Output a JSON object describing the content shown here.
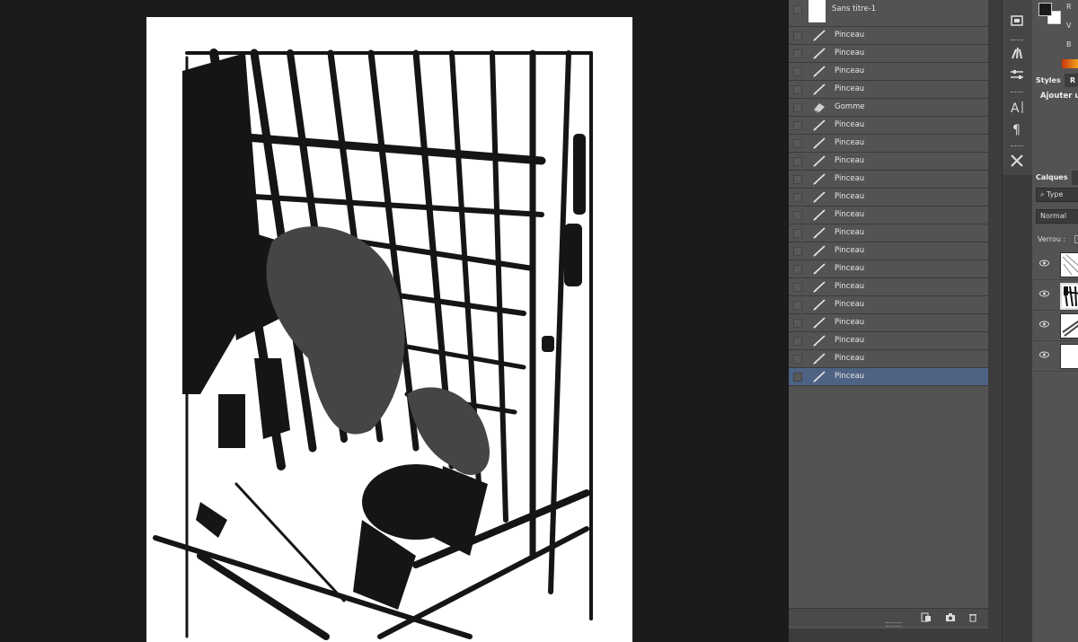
{
  "history": {
    "snapshot_label": "Sans titre-1",
    "steps": [
      {
        "label": "Pinceau",
        "icon": "brush-icon"
      },
      {
        "label": "Pinceau",
        "icon": "brush-icon"
      },
      {
        "label": "Pinceau",
        "icon": "brush-icon"
      },
      {
        "label": "Pinceau",
        "icon": "brush-icon"
      },
      {
        "label": "Gomme",
        "icon": "eraser-icon"
      },
      {
        "label": "Pinceau",
        "icon": "brush-icon"
      },
      {
        "label": "Pinceau",
        "icon": "brush-icon"
      },
      {
        "label": "Pinceau",
        "icon": "brush-icon"
      },
      {
        "label": "Pinceau",
        "icon": "brush-icon"
      },
      {
        "label": "Pinceau",
        "icon": "brush-icon"
      },
      {
        "label": "Pinceau",
        "icon": "brush-icon"
      },
      {
        "label": "Pinceau",
        "icon": "brush-icon"
      },
      {
        "label": "Pinceau",
        "icon": "brush-icon"
      },
      {
        "label": "Pinceau",
        "icon": "brush-icon"
      },
      {
        "label": "Pinceau",
        "icon": "brush-icon"
      },
      {
        "label": "Pinceau",
        "icon": "brush-icon"
      },
      {
        "label": "Pinceau",
        "icon": "brush-icon"
      },
      {
        "label": "Pinceau",
        "icon": "brush-icon"
      },
      {
        "label": "Pinceau",
        "icon": "brush-icon"
      },
      {
        "label": "Pinceau",
        "icon": "brush-icon"
      }
    ],
    "active_index": 19
  },
  "color_panel": {
    "channels": [
      "R",
      "V",
      "B"
    ],
    "foreground": "#1a1a1a",
    "background": "#ffffff"
  },
  "styles_panel": {
    "tabs": [
      "Styles",
      "R"
    ],
    "add_label": "Ajouter un"
  },
  "layers_panel": {
    "tabs": [
      "Calques"
    ],
    "filter_label": "Type",
    "blend_mode": "Normal",
    "lock_label": "Verrou :"
  },
  "colors": {
    "accent_selection": "#4e6384",
    "panel": "#535353",
    "canvas_bg": "#1b1b1b"
  }
}
